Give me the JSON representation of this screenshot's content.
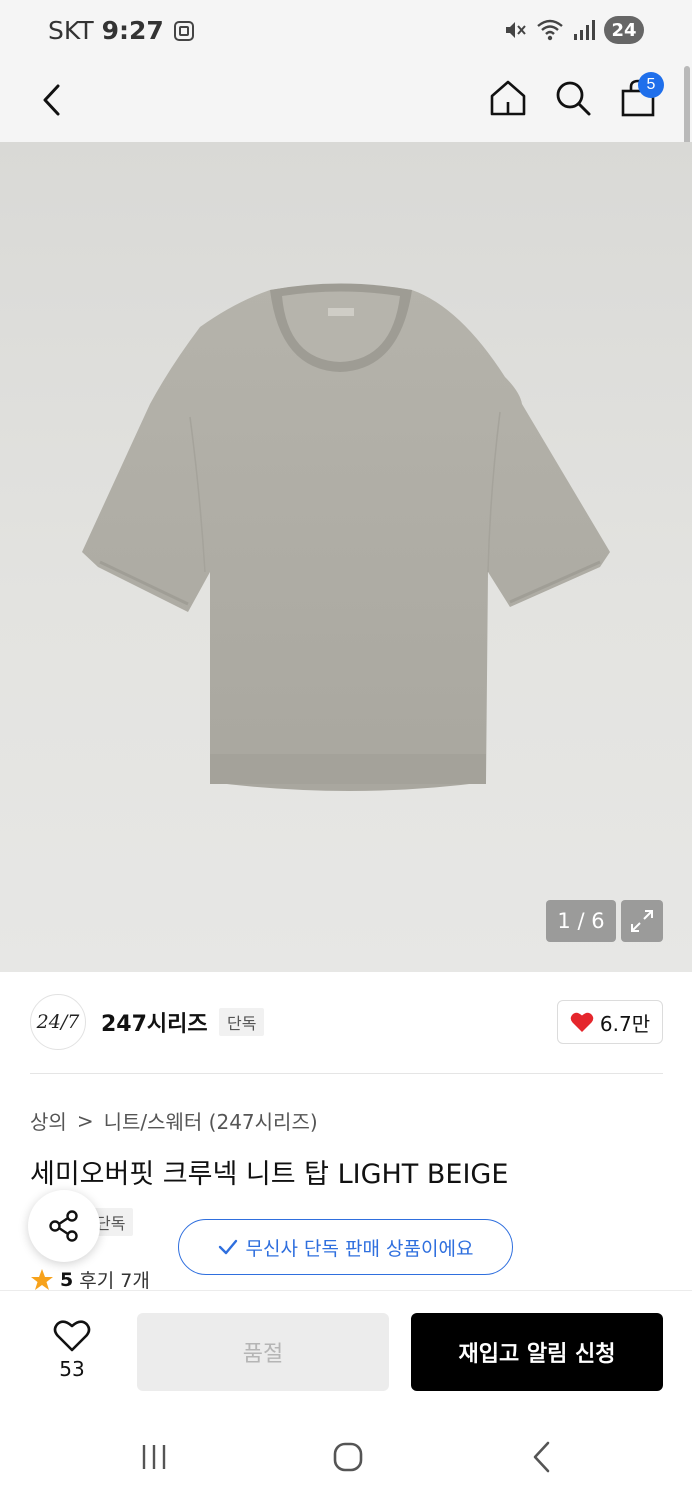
{
  "status_bar": {
    "carrier": "SKT",
    "time": "9:27",
    "battery": "24"
  },
  "header": {
    "cart_count": "5"
  },
  "gallery": {
    "counter": "1 / 6",
    "image_subject": "Light beige short-sleeve crew neck knit top"
  },
  "brand": {
    "logo_text": "24/7",
    "name": "247시리즈",
    "exclusive_tag": "단독",
    "likes": "6.7만"
  },
  "product": {
    "breadcrumb": [
      "상의",
      ">",
      "니트/스웨터 (247시리즈)"
    ],
    "title": "세미오버핏 크루넥 니트 탑 LIGHT BEIGE",
    "exclusive_tag_partial": "단독",
    "notice": "무신사 단독 판매 상품이에요",
    "rating_score": "5",
    "review_label": "후기 7개"
  },
  "bottom": {
    "wish_count": "53",
    "soldout_label": "품절",
    "restock_label": "재입고 알림 신청"
  },
  "colors": {
    "accent_blue": "#2f6fde",
    "badge_blue": "#1f6feb",
    "heart_red": "#e5262c",
    "star_orange": "#f7a21b",
    "shirt_beige": "#b0aea6"
  }
}
